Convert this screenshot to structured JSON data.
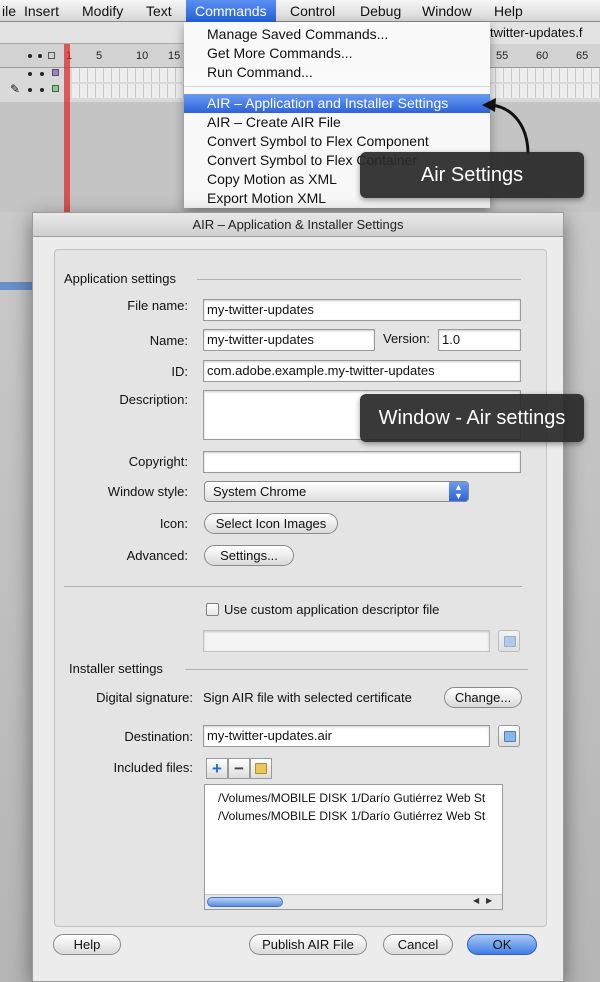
{
  "menubar": {
    "items": [
      {
        "label": "File"
      },
      {
        "label": "Insert"
      },
      {
        "label": "Modify"
      },
      {
        "label": "Text"
      },
      {
        "label": "Commands"
      },
      {
        "label": "Control"
      },
      {
        "label": "Debug"
      },
      {
        "label": "Window"
      },
      {
        "label": "Help"
      }
    ],
    "visible_first_label": "ile"
  },
  "background": {
    "document_title": "twitter-updates.f",
    "timeline_ticks": [
      "1",
      "5",
      "10",
      "15",
      "55",
      "60",
      "65"
    ]
  },
  "commands_menu": {
    "items": [
      {
        "label": "Manage Saved Commands..."
      },
      {
        "label": "Get More Commands..."
      },
      {
        "label": "Run Command..."
      },
      {
        "label": "AIR – Application and Installer Settings"
      },
      {
        "label": "AIR – Create AIR File"
      },
      {
        "label": "Convert Symbol to Flex Component"
      },
      {
        "label": "Convert Symbol to Flex Container"
      },
      {
        "label": "Copy Motion as XML"
      },
      {
        "label": "Export Motion XML"
      }
    ],
    "selected_index": 3
  },
  "callouts": {
    "air_settings": "Air Settings",
    "window_air_settings": "Window - Air settings"
  },
  "dialog": {
    "title": "AIR – Application & Installer Settings",
    "app_section": "Application settings",
    "file_name_label": "File name:",
    "file_name_value": "my-twitter-updates",
    "name_label": "Name:",
    "name_value": "my-twitter-updates",
    "version_label": "Version:",
    "version_value": "1.0",
    "id_label": "ID:",
    "id_value": "com.adobe.example.my-twitter-updates",
    "description_label": "Description:",
    "description_value": "",
    "copyright_label": "Copyright:",
    "copyright_value": "",
    "window_style_label": "Window style:",
    "window_style_value": "System Chrome",
    "icon_label": "Icon:",
    "icon_button": "Select Icon Images",
    "advanced_label": "Advanced:",
    "settings_button": "Settings...",
    "custom_descriptor_label": "Use custom application descriptor file",
    "custom_descriptor_checked": false,
    "custom_descriptor_path": "",
    "installer_section": "Installer settings",
    "signature_label": "Digital signature:",
    "signature_value": "Sign AIR file with selected certificate",
    "change_button": "Change...",
    "destination_label": "Destination:",
    "destination_value": "my-twitter-updates.air",
    "included_files_label": "Included files:",
    "included_files": [
      "/Volumes/MOBILE DISK 1/Darío Gutiérrez Web St",
      "/Volumes/MOBILE DISK 1/Darío Gutiérrez Web St"
    ],
    "add_symbol": "+",
    "remove_symbol": "−",
    "buttons": {
      "help": "Help",
      "publish": "Publish AIR File",
      "cancel": "Cancel",
      "ok": "OK"
    }
  }
}
